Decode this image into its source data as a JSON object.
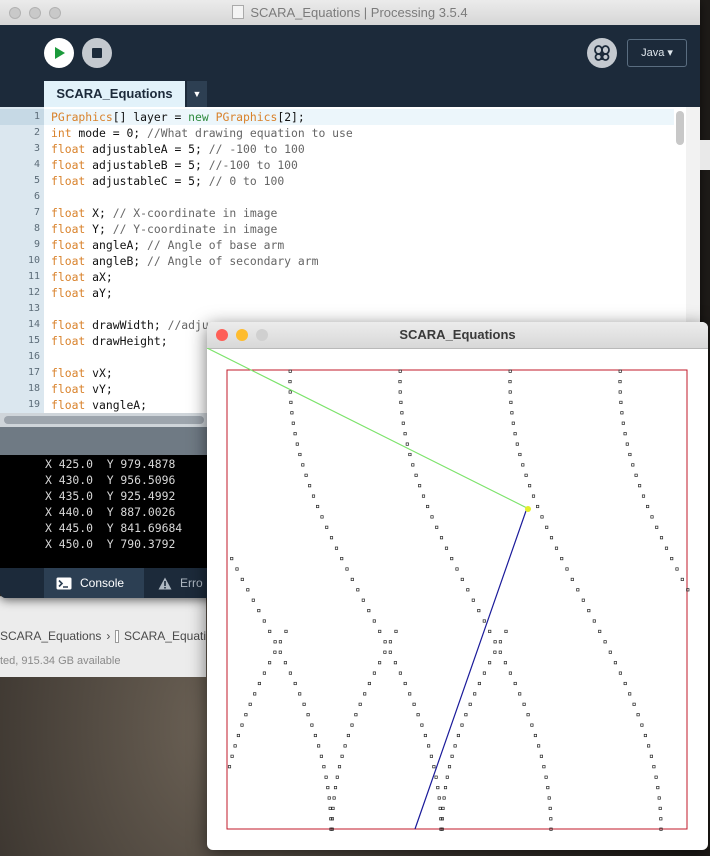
{
  "ide": {
    "window_title": "SCARA_Equations | Processing 3.5.4",
    "mode_label": "Java ▾",
    "tab_label": "SCARA_Equations",
    "tab_menu_glyph": "▼",
    "code_lines": [
      [
        {
          "t": "k",
          "s": "PGraphics"
        },
        {
          "t": "p",
          "s": "[] layer = "
        },
        {
          "t": "k",
          "s": "new"
        },
        {
          "t": "p",
          "s": " "
        },
        {
          "t": "k",
          "s": "PGraphics"
        },
        {
          "t": "p",
          "s": "[2];"
        }
      ],
      [
        {
          "t": "k",
          "s": "int"
        },
        {
          "t": "p",
          "s": " mode = 0; "
        },
        {
          "t": "c",
          "s": "//What drawing equation to use"
        }
      ],
      [
        {
          "t": "k",
          "s": "float"
        },
        {
          "t": "p",
          "s": " adjustableA = 5; "
        },
        {
          "t": "c",
          "s": "// -100 to 100"
        }
      ],
      [
        {
          "t": "k",
          "s": "float"
        },
        {
          "t": "p",
          "s": " adjustableB = 5; "
        },
        {
          "t": "c",
          "s": "//-100 to 100"
        }
      ],
      [
        {
          "t": "k",
          "s": "float"
        },
        {
          "t": "p",
          "s": " adjustableC = 5; "
        },
        {
          "t": "c",
          "s": "// 0 to 100"
        }
      ],
      [],
      [
        {
          "t": "k",
          "s": "float"
        },
        {
          "t": "p",
          "s": " X; "
        },
        {
          "t": "c",
          "s": "// X-coordinate in image"
        }
      ],
      [
        {
          "t": "k",
          "s": "float"
        },
        {
          "t": "p",
          "s": " Y; "
        },
        {
          "t": "c",
          "s": "// Y-coordinate in image"
        }
      ],
      [
        {
          "t": "k",
          "s": "float"
        },
        {
          "t": "p",
          "s": " angleA; "
        },
        {
          "t": "c",
          "s": "// Angle of base arm"
        }
      ],
      [
        {
          "t": "k",
          "s": "float"
        },
        {
          "t": "p",
          "s": " angleB; "
        },
        {
          "t": "c",
          "s": "// Angle of secondary arm"
        }
      ],
      [
        {
          "t": "k",
          "s": "float"
        },
        {
          "t": "p",
          "s": " aX;"
        }
      ],
      [
        {
          "t": "k",
          "s": "float"
        },
        {
          "t": "p",
          "s": " aY;"
        }
      ],
      [],
      [
        {
          "t": "k",
          "s": "float"
        },
        {
          "t": "p",
          "s": " drawWidth; "
        },
        {
          "t": "c",
          "s": "//adju"
        }
      ],
      [
        {
          "t": "k",
          "s": "float"
        },
        {
          "t": "p",
          "s": " drawHeight;"
        }
      ],
      [],
      [
        {
          "t": "k",
          "s": "float"
        },
        {
          "t": "p",
          "s": " vX;"
        }
      ],
      [
        {
          "t": "k",
          "s": "float"
        },
        {
          "t": "p",
          "s": " vY;"
        }
      ],
      [
        {
          "t": "k",
          "s": "float"
        },
        {
          "t": "p",
          "s": " vangleA;"
        }
      ]
    ],
    "line_numbers": [
      "1",
      "2",
      "3",
      "4",
      "5",
      "6",
      "7",
      "8",
      "9",
      "10",
      "11",
      "12",
      "13",
      "14",
      "15",
      "16",
      "17",
      "18",
      "19"
    ],
    "console_lines": [
      "X 425.0  Y 979.4878",
      "X 430.0  Y 956.5096",
      "X 435.0  Y 925.4992",
      "X 440.0  Y 887.0026",
      "X 445.0  Y 841.69684",
      "X 450.0  Y 790.3792"
    ],
    "console_tab_label": "Console",
    "errors_tab_label": "Erro"
  },
  "finder": {
    "path_item_1": "SCARA_Equations",
    "path_separator": "›",
    "path_item_2": "SCARA_Equati",
    "status_text": "ted, 915.34 GB available"
  },
  "sketch": {
    "window_title": "SCARA_Equations"
  },
  "colors": {
    "ide_bg": "#1c2a3a",
    "keyword": "#d9822b",
    "type": "#2f8b3e",
    "frame_red": "#c0192a",
    "arm_green": "#7be36a",
    "arm_blue": "#1a1a9a",
    "joint": "#e4ef2b",
    "close_red": "#fe5f57",
    "minimize_yellow": "#febc2e",
    "zoom_green": "#28c840"
  }
}
